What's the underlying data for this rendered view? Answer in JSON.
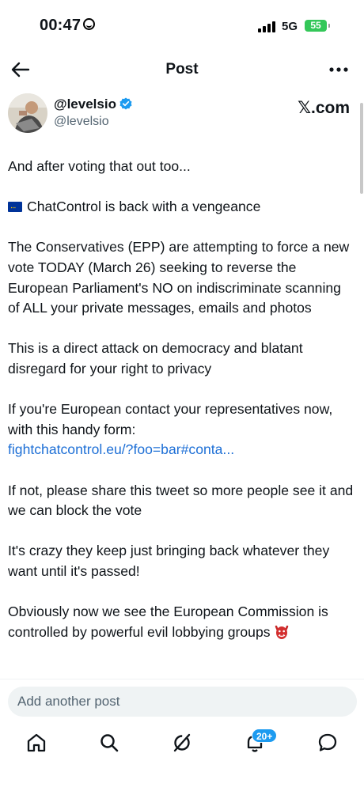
{
  "status_bar": {
    "time": "00:47",
    "network": "5G",
    "battery": "55"
  },
  "header": {
    "title": "Post",
    "back_icon": "arrow-left-icon",
    "more_icon": "more-horizontal-icon"
  },
  "author": {
    "display_name": "@levelsio",
    "handle": "@levelsio",
    "verified": true
  },
  "brand": {
    "x_glyph": "𝕏",
    "suffix": ".com"
  },
  "tweet": {
    "p1": "And after voting that out too...",
    "p2": "ChatControl is back with a vengeance",
    "p3": "The Conservatives (EPP) are attempting to force a new vote TODAY (March 26) seeking to reverse the European Parliament's NO on indiscriminate scanning of ALL your private messages, emails and photos",
    "p4": "This is a direct attack on democracy and blatant disregard for your right to privacy",
    "p5_text": "If you're European contact your representatives now, with this handy form:",
    "p5_link": "fightchatcontrol.eu/?foo=bar#conta...",
    "p6": "If not, please share this tweet so more people see it and we can block the vote",
    "p7": "It's crazy they keep just bringing back whatever they want until it's passed!",
    "p8": "Obviously now we see the European Commission is controlled by powerful evil lobbying groups",
    "flag_emoji": "eu-flag-icon",
    "end_emoji": "ogre-icon"
  },
  "compose": {
    "placeholder": "Add another post"
  },
  "tab_bar": {
    "items": [
      "home-icon",
      "search-icon",
      "grok-icon",
      "notifications-icon",
      "messages-icon"
    ],
    "notifications_badge": "20+"
  },
  "colors": {
    "link": "#1d6fd6",
    "verified": "#1d9bf0",
    "badge": "#1d9bf0",
    "battery": "#34c759"
  }
}
